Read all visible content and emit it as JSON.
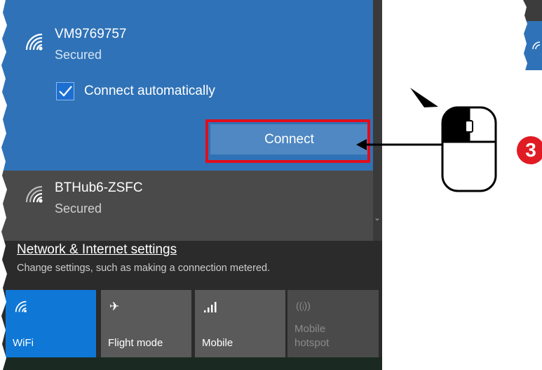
{
  "networks": [
    {
      "ssid": "VM9769757",
      "status": "Secured",
      "selected": true
    },
    {
      "ssid": "BTHub6-ZSFC",
      "status": "Secured",
      "selected": false
    }
  ],
  "connect_auto": {
    "label": "Connect automatically",
    "checked": true
  },
  "connect_button": {
    "label": "Connect"
  },
  "settings": {
    "link": "Network & Internet settings",
    "description": "Change settings, such as making a connection metered."
  },
  "quick_actions": [
    {
      "label": "WiFi",
      "icon": "wifi-icon",
      "active": true
    },
    {
      "label": "Flight mode",
      "icon": "airplane-icon",
      "active": false
    },
    {
      "label": "Mobile",
      "icon": "signal-bars-icon",
      "active": false
    },
    {
      "label": "Mobile\nhotspot",
      "icon": "hotspot-icon",
      "active": false
    }
  ],
  "annotation": {
    "step": "3"
  },
  "colors": {
    "selected_bg": "#2f72b7",
    "tile_active": "#0f77d6",
    "highlight": "#e20d1b",
    "step_badge": "#e01b24"
  }
}
